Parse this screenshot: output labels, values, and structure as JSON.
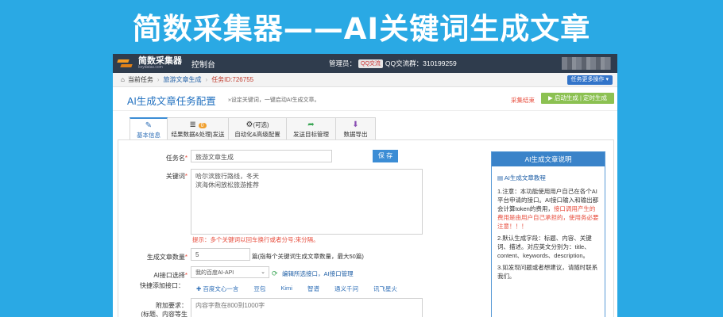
{
  "banner": {
    "title": "简数采集器——AI关键词生成文章"
  },
  "topbar": {
    "brand": "简数采集器",
    "domain": "keydatas.com",
    "control_panel": "控制台",
    "admin_label": "管理员：",
    "qq_badge": "QQ交流",
    "qq_group": "QQ交流群：310199259"
  },
  "breadcrumb": {
    "current_task_label": "当前任务",
    "task_name": "旅游文章生成",
    "task_id": "任务ID:726755",
    "more_ops": "任务更多操作 ▾"
  },
  "page": {
    "title": "AI生成文章任务配置",
    "subtitle": "»设定关键词，一键启动AI生成文章。",
    "stop_label": "采集结束",
    "start_button": "▶ 启动生成 | 定时生成"
  },
  "tabs": [
    {
      "icon": "✎",
      "label": "基本信息"
    },
    {
      "icon": "≣",
      "badge": "0",
      "label": "结果数据&处理|发送"
    },
    {
      "icon": "⚙",
      "hint": "(可选)",
      "label": "自动化&高级配置"
    },
    {
      "icon": "➦",
      "label": "发送目标管理"
    },
    {
      "icon": "⬇",
      "label": "数据导出"
    }
  ],
  "form": {
    "task_name_label": "任务名",
    "task_name_value": "旅游文章生成",
    "save_button": "保 存",
    "keywords_label": "关键词",
    "keywords_line1": "哈尔滨旅行路线，冬天",
    "keywords_line2": "滨海休闲放松旅游推荐",
    "keywords_tip": "提示：多个关键词以回车换行或者分号;來分隔。",
    "count_label": "生成文章数量",
    "count_value": "5",
    "count_note": "篇(指每个关键词生成文章数量，最大50篇)",
    "ai_label": "AI接口选择",
    "ai_value": "我的百度AI-API",
    "ai_ops": "编辑所选接口，AI接口管理",
    "quick_label": "快捷添加接口：",
    "quick_items": [
      "✚ 百度文心一言",
      "豆包",
      "Kimi",
      "智谱",
      "通义千问",
      "讯飞星火"
    ],
    "extra_label": "附加要求：",
    "extra_label2": "(标题、内容等生",
    "extra_placeholder": "内容字数在800到1000字"
  },
  "sidebar": {
    "title": "AI生成文章说明",
    "tutorial": "AI生成文章教程",
    "note1a": "1.注意：本功能使用用户自己在各个AI平台申请的接口。AI接口输入和输出都会计算token的费用，",
    "note1b": "接口调用产生的费用是由用户自己承担的，使用务必要注意！！！",
    "note2": "2.默认生成字段：标题、内容、关键词、描述。对应英文分别为：title、content、keywords、description。",
    "note3": "3.如发现问题或者想建议，请随时联系我们。"
  },
  "colors": {
    "banner_bg": "#2aa9e4",
    "topbar": "#2f3c4d",
    "accent": "#3c8dd5",
    "start_green": "#8cc152",
    "danger": "#e74c3c"
  }
}
